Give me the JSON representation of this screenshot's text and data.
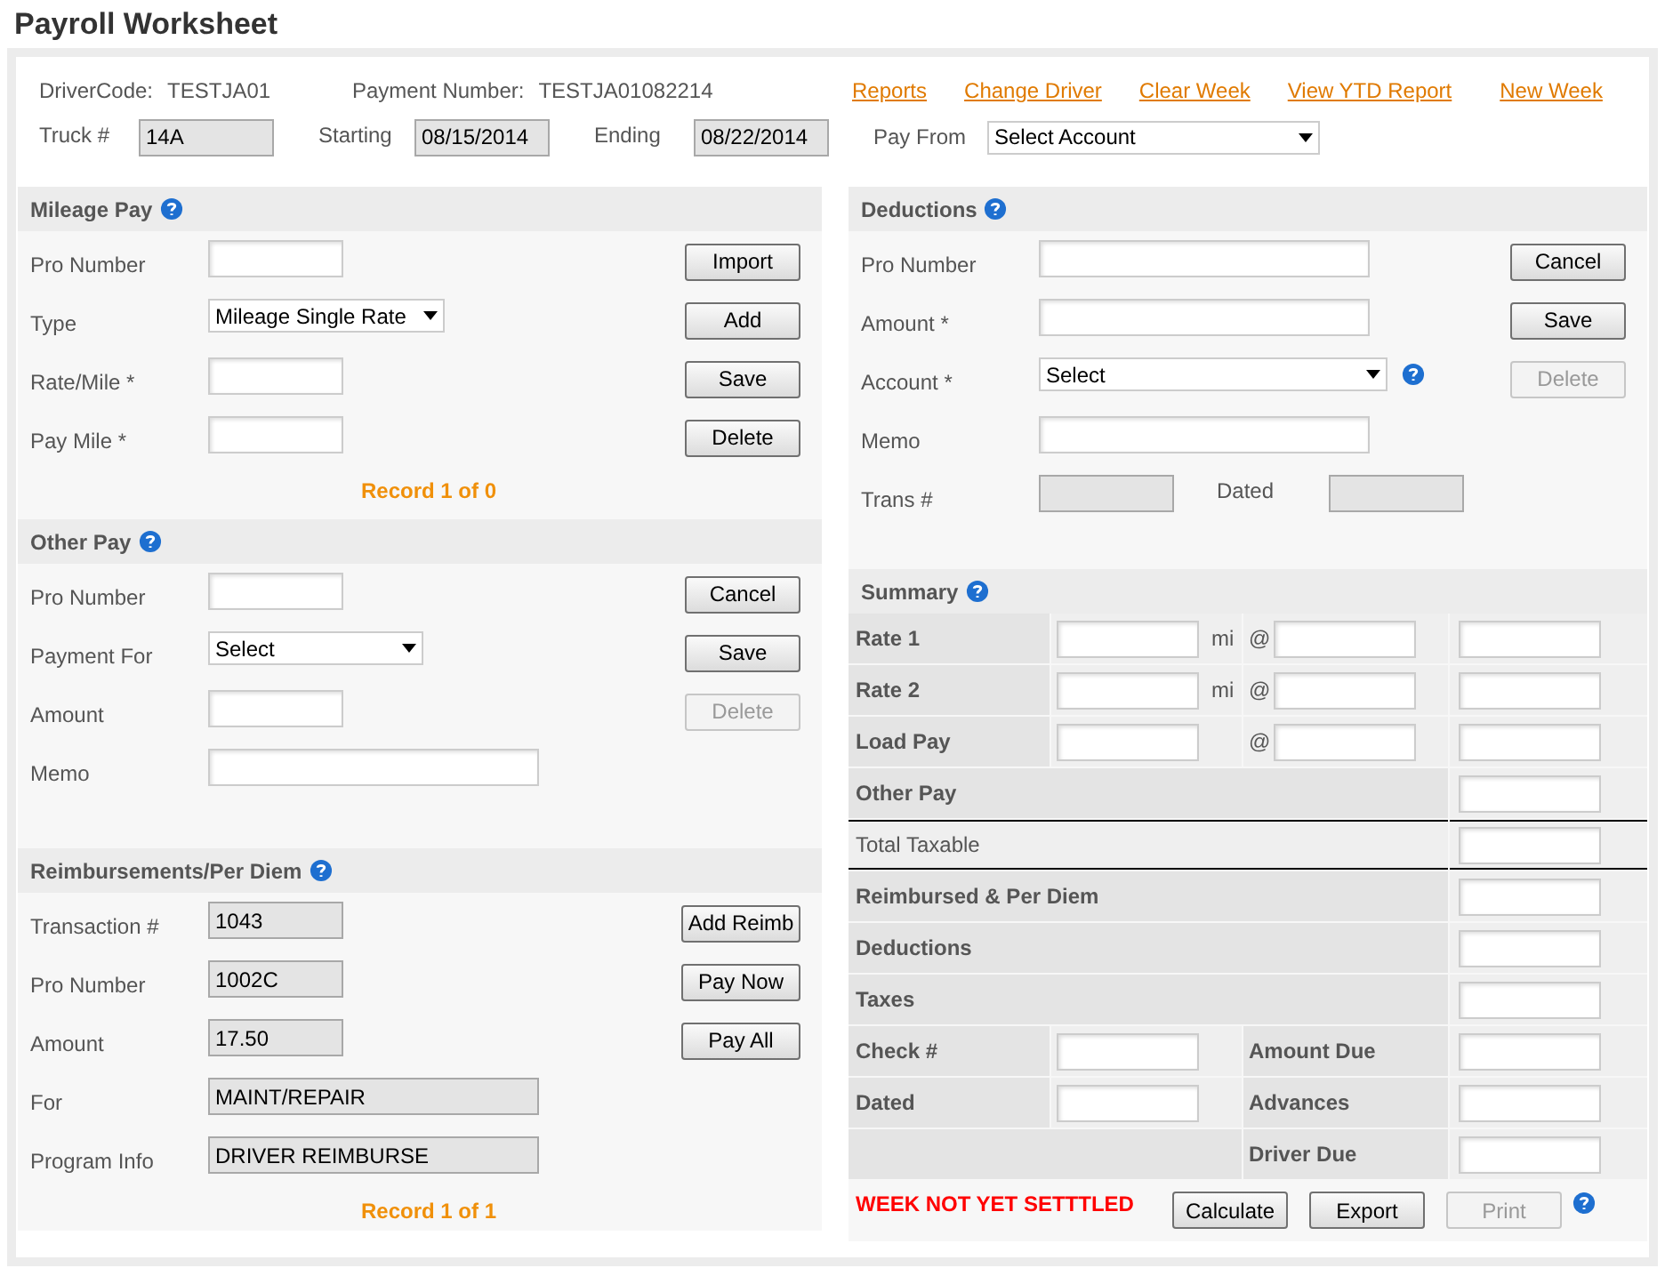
{
  "title": "Payroll Worksheet",
  "header": {
    "info": [
      {
        "label": "DriverCode:",
        "value": "TESTJA01"
      },
      {
        "label": "Payment Number:",
        "value": "TESTJA01082214"
      }
    ],
    "links": [
      "Reports",
      "Change Driver",
      "Clear Week",
      "View YTD Report",
      "New Week"
    ],
    "fields": [
      {
        "label": "Truck #",
        "kind": "locked",
        "value": "14A"
      },
      {
        "label": "Starting",
        "kind": "locked",
        "value": "08/15/2014"
      },
      {
        "label": "Ending",
        "kind": "locked",
        "value": "08/22/2014"
      },
      {
        "label": "Pay From",
        "kind": "select",
        "value": "Select Account"
      }
    ]
  },
  "mileage_pay": {
    "title": "Mileage Pay",
    "rows": [
      {
        "label": "Pro Number",
        "kind": "input"
      },
      {
        "label": "Type",
        "kind": "select",
        "value": "Mileage Single Rate"
      },
      {
        "label": "Rate/Mile *",
        "kind": "input"
      },
      {
        "label": "Pay Mile *",
        "kind": "input"
      }
    ],
    "buttons": [
      {
        "label": "Import",
        "disabled": false
      },
      {
        "label": "Add",
        "disabled": false
      },
      {
        "label": "Save",
        "disabled": false
      },
      {
        "label": "Delete",
        "disabled": false
      }
    ],
    "record": "Record 1 of 0"
  },
  "other_pay": {
    "title": "Other Pay",
    "rows": [
      {
        "label": "Pro Number",
        "kind": "input"
      },
      {
        "label": "Payment For",
        "kind": "select",
        "value": "Select"
      },
      {
        "label": "Amount",
        "kind": "input"
      },
      {
        "label": "Memo",
        "kind": "input_wide"
      }
    ],
    "buttons": [
      {
        "label": "Cancel",
        "disabled": false
      },
      {
        "label": "Save",
        "disabled": false
      },
      {
        "label": "Delete",
        "disabled": true
      }
    ]
  },
  "reimbursements": {
    "title": "Reimbursements/Per Diem",
    "rows": [
      {
        "label": "Transaction #",
        "kind": "locked",
        "value": "1043"
      },
      {
        "label": "Pro Number",
        "kind": "locked",
        "value": "1002C"
      },
      {
        "label": "Amount",
        "kind": "locked",
        "value": "17.50"
      },
      {
        "label": "For",
        "kind": "locked_wide",
        "value": "MAINT/REPAIR"
      },
      {
        "label": "Program Info",
        "kind": "locked_wide",
        "value": "DRIVER REIMBURSE"
      }
    ],
    "buttons": [
      {
        "label": "Add Reimb",
        "disabled": false
      },
      {
        "label": "Pay Now",
        "disabled": false
      },
      {
        "label": "Pay All",
        "disabled": false
      }
    ],
    "record": "Record 1 of 1"
  },
  "deductions": {
    "title": "Deductions",
    "rows": [
      {
        "label": "Pro Number",
        "kind": "input_wide",
        "help": false
      },
      {
        "label": "Amount *",
        "kind": "input_wide",
        "help": false
      },
      {
        "label": "Account *",
        "kind": "select",
        "value": "Select",
        "help": true
      },
      {
        "label": "Memo",
        "kind": "input_wide",
        "help": false
      },
      {
        "label": "Trans #",
        "kind": "locked",
        "help": false,
        "extra": {
          "label": "Dated",
          "kind": "locked"
        }
      }
    ],
    "buttons": [
      {
        "label": "Cancel",
        "disabled": false
      },
      {
        "label": "Save",
        "disabled": false
      },
      {
        "label": "Delete",
        "disabled": true
      }
    ]
  },
  "summary": {
    "title": "Summary",
    "rows": [
      {
        "kind": "rate",
        "label": "Rate 1",
        "unit": "mi",
        "at": "@"
      },
      {
        "kind": "rate",
        "label": "Rate 2",
        "unit": "mi",
        "at": "@"
      },
      {
        "kind": "rate",
        "label": "Load Pay",
        "at": "@"
      },
      {
        "kind": "total",
        "label": "Other Pay"
      },
      {
        "kind": "taxable",
        "label": "Total Taxable"
      },
      {
        "kind": "total",
        "label": "Reimbursed & Per Diem"
      },
      {
        "kind": "total",
        "label": "Deductions"
      },
      {
        "kind": "total",
        "label": "Taxes"
      },
      {
        "kind": "split",
        "label": "Check #",
        "label_2": "Amount Due"
      },
      {
        "kind": "split",
        "label": "Dated",
        "label_2": "Advances"
      },
      {
        "kind": "due",
        "label_2": "Driver Due"
      }
    ],
    "status": "WEEK NOT YET SETTTLED",
    "buttons": [
      {
        "label": "Calculate",
        "disabled": false
      },
      {
        "label": "Export",
        "disabled": false
      },
      {
        "label": "Print",
        "disabled": true
      }
    ]
  }
}
